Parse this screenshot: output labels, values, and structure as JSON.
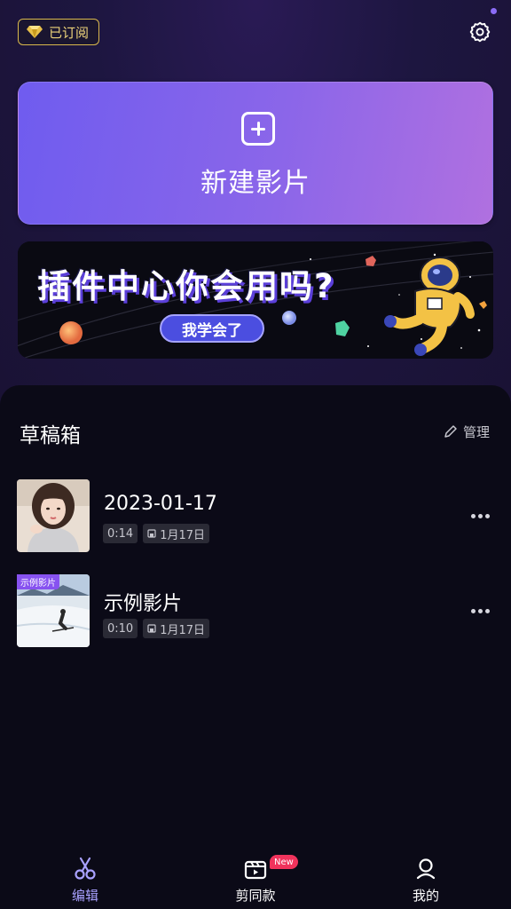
{
  "header": {
    "subscription_label": "已订阅",
    "subscription_icon": "diamond-icon",
    "settings_icon": "gear-icon"
  },
  "new_project": {
    "label": "新建影片",
    "icon": "plus-square-icon"
  },
  "banner": {
    "headline": "插件中心你会用吗?",
    "cta": "我学会了"
  },
  "drafts": {
    "title": "草稿箱",
    "manage_label": "管理",
    "items": [
      {
        "name": "2023-01-17",
        "duration": "0:14",
        "date": "1月17日",
        "tag": ""
      },
      {
        "name": "示例影片",
        "duration": "0:10",
        "date": "1月17日",
        "tag": "示例影片"
      }
    ]
  },
  "tabbar": {
    "tabs": [
      {
        "label": "编辑",
        "icon": "scissors-icon",
        "active": true
      },
      {
        "label": "剪同款",
        "icon": "template-video-icon",
        "badge": "New"
      },
      {
        "label": "我的",
        "icon": "profile-icon"
      }
    ]
  },
  "colors": {
    "accent": "#a9a1ff",
    "card_gradient_start": "#6f5cef",
    "card_gradient_end": "#b070e0",
    "badge_gold": "#d9b84c",
    "new_badge": "#f0335c"
  }
}
